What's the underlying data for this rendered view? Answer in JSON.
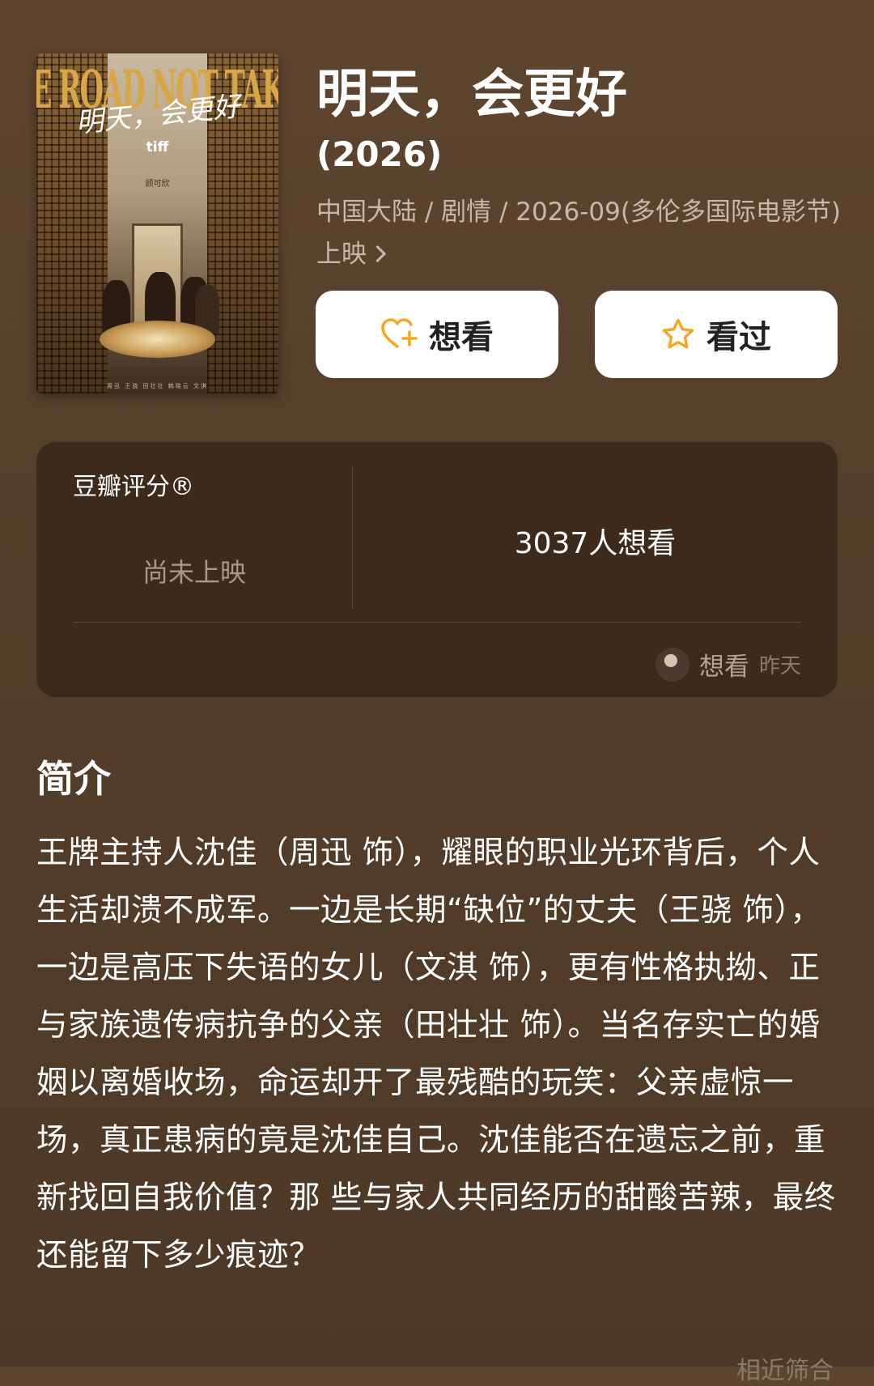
{
  "poster": {
    "title_en": "THE ROAD NOT TAKEN",
    "title_cn_script": "明天，会更好",
    "festival_mark": "tiff",
    "director_line": "顾可欣",
    "credits_line": "周迅  王骁  田壮壮  韩晓云  文淇"
  },
  "movie": {
    "title": "明天，会更好",
    "year": "(2026)",
    "meta": "中国大陆 / 剧情 / 2026-09(多伦多国际电影节)上映"
  },
  "actions": {
    "want_label": "想看",
    "seen_label": "看过"
  },
  "rating": {
    "label": "豆瓣评分®",
    "status": "尚未上映",
    "want_count": "3037人想看",
    "recent_action": "想看",
    "recent_time": "昨天"
  },
  "synopsis": {
    "title": "简介",
    "text": "王牌主持人沈佳（周迅 饰），耀眼的职业光环背后，个人生活却溃不成军。一边是长期“缺位”的丈夫（王骁 饰），一边是高压下失语的女儿（文淇 饰），更有性格执拗、正与家族遗传病抗争的父亲（田壮壮 饰）。当名存实亡的婚姻以离婚收场，命运却开了最残酷的玩笑：父亲虚惊一场，真正患病的竟是沈佳自己。沈佳能否在遗忘之前，重新找回自我价值？那 些与家人共同经历的甜酸苦辣，最终还能留下多少痕迹？",
    "more_hint": "相近筛合"
  },
  "colors": {
    "background": "#56402c",
    "card": "#3a2a1c",
    "icon_accent": "#f5a623"
  },
  "icons": {
    "want": "heart-plus-icon",
    "seen": "star-icon"
  }
}
